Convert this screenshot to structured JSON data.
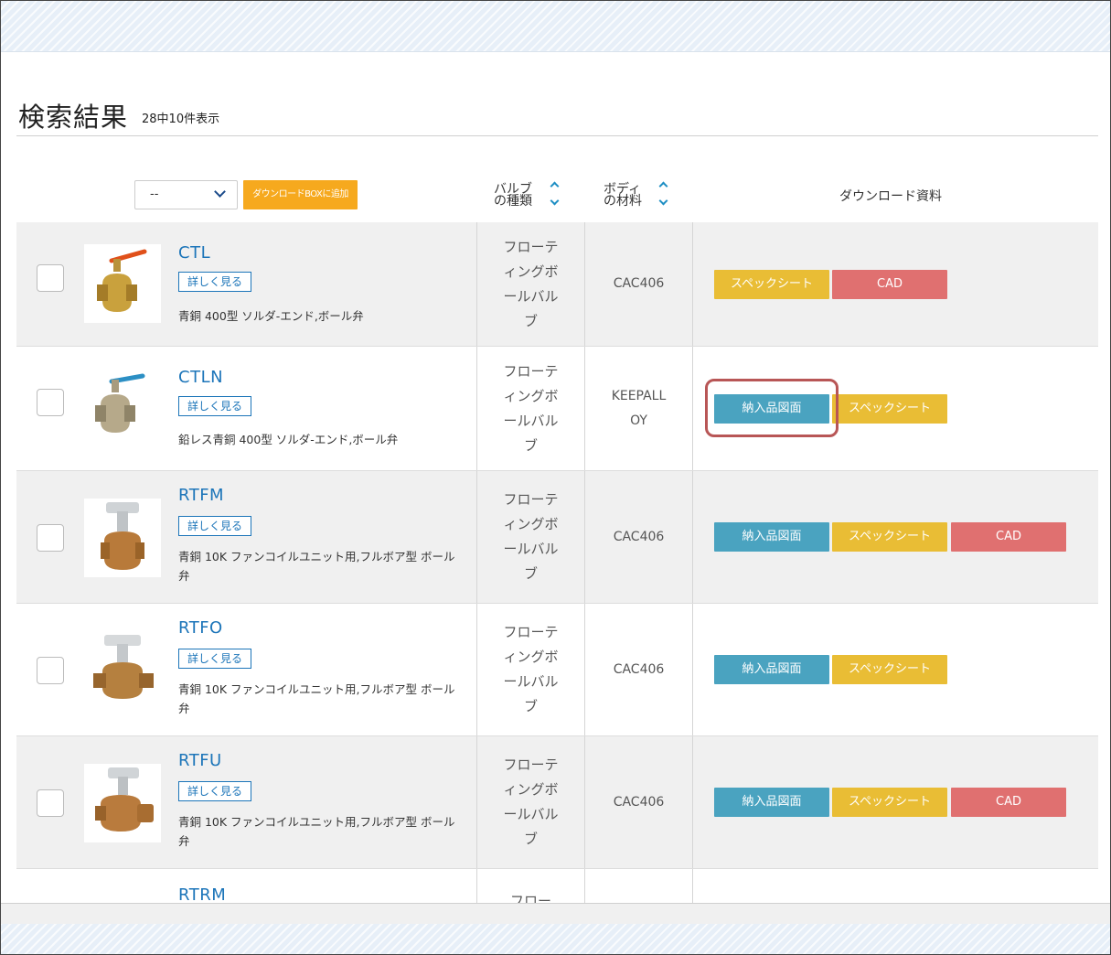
{
  "header": {
    "title": "検索結果",
    "count": "28中10件表示"
  },
  "toolbar": {
    "select_value": "--",
    "add_button": "ダウンロードBOXに追加",
    "col_valve_type": [
      "バルブ",
      "の種類"
    ],
    "col_material": [
      "ボディ",
      "の材料"
    ],
    "col_download": "ダウンロード資料"
  },
  "colors": {
    "link": "#1c75b9",
    "add": "#f6a91e",
    "blue": "#4aa3c0",
    "yellow": "#e9bd35",
    "red": "#e07070",
    "highlight": "#b85656"
  },
  "rows": [
    {
      "name": "CTL",
      "detail": "詳しく見る",
      "desc": "青銅 400型 ソルダ-エンド,ボール弁",
      "valve_type": "フローティングボールバルブ",
      "material": "CAC406",
      "buttons": [
        "スペックシート",
        "CAD"
      ],
      "image": "ball-valve-orange-handle"
    },
    {
      "name": "CTLN",
      "detail": "詳しく見る",
      "desc": "鉛レス青銅 400型 ソルダ-エンド,ボール弁",
      "valve_type": "フローティングボールバルブ",
      "material": "KEEPALLOY",
      "buttons": [
        "納入品図面",
        "スペックシート"
      ],
      "image": "ball-valve-blue-handle"
    },
    {
      "name": "RTFM",
      "detail": "詳しく見る",
      "desc": "青銅 10K ファンコイルユニット用,フルボア型 ボール弁",
      "valve_type": "フローティングボールバルブ",
      "material": "CAC406",
      "buttons": [
        "納入品図面",
        "スペックシート",
        "CAD"
      ],
      "image": "t-handle-valve"
    },
    {
      "name": "RTFO",
      "detail": "詳しく見る",
      "desc": "青銅 10K ファンコイルユニット用,フルボア型 ボール弁",
      "valve_type": "フローティングボールバルブ",
      "material": "CAC406",
      "buttons": [
        "納入品図面",
        "スペックシート"
      ],
      "image": "t-handle-valve-long"
    },
    {
      "name": "RTFU",
      "detail": "詳しく見る",
      "desc": "青銅 10K ファンコイルユニット用,フルボア型 ボール弁",
      "valve_type": "フローティングボールバルブ",
      "material": "CAC406",
      "buttons": [
        "納入品図面",
        "スペックシート",
        "CAD"
      ],
      "image": "t-handle-valve-union"
    },
    {
      "name": "RTRM",
      "valve_type": "フロー"
    }
  ]
}
